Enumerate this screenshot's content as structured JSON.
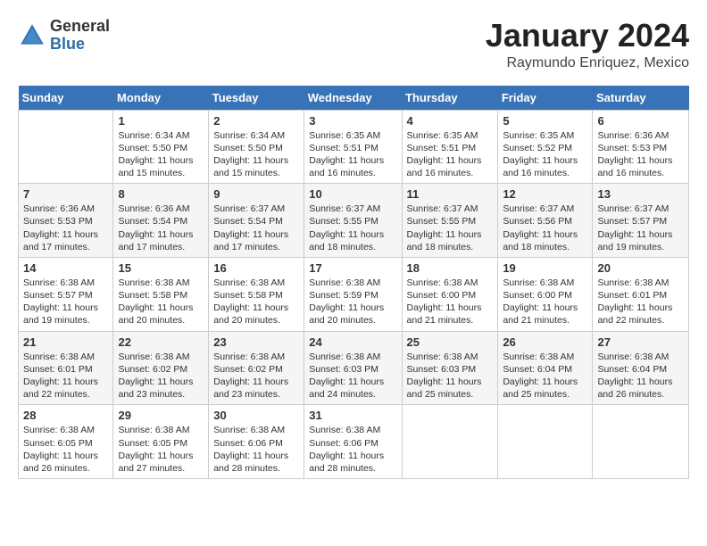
{
  "logo": {
    "general": "General",
    "blue": "Blue"
  },
  "title": "January 2024",
  "location": "Raymundo Enriquez, Mexico",
  "headers": [
    "Sunday",
    "Monday",
    "Tuesday",
    "Wednesday",
    "Thursday",
    "Friday",
    "Saturday"
  ],
  "weeks": [
    [
      {
        "day": "",
        "sunrise": "",
        "sunset": "",
        "daylight": ""
      },
      {
        "day": "1",
        "sunrise": "Sunrise: 6:34 AM",
        "sunset": "Sunset: 5:50 PM",
        "daylight": "Daylight: 11 hours and 15 minutes."
      },
      {
        "day": "2",
        "sunrise": "Sunrise: 6:34 AM",
        "sunset": "Sunset: 5:50 PM",
        "daylight": "Daylight: 11 hours and 15 minutes."
      },
      {
        "day": "3",
        "sunrise": "Sunrise: 6:35 AM",
        "sunset": "Sunset: 5:51 PM",
        "daylight": "Daylight: 11 hours and 16 minutes."
      },
      {
        "day": "4",
        "sunrise": "Sunrise: 6:35 AM",
        "sunset": "Sunset: 5:51 PM",
        "daylight": "Daylight: 11 hours and 16 minutes."
      },
      {
        "day": "5",
        "sunrise": "Sunrise: 6:35 AM",
        "sunset": "Sunset: 5:52 PM",
        "daylight": "Daylight: 11 hours and 16 minutes."
      },
      {
        "day": "6",
        "sunrise": "Sunrise: 6:36 AM",
        "sunset": "Sunset: 5:53 PM",
        "daylight": "Daylight: 11 hours and 16 minutes."
      }
    ],
    [
      {
        "day": "7",
        "sunrise": "Sunrise: 6:36 AM",
        "sunset": "Sunset: 5:53 PM",
        "daylight": "Daylight: 11 hours and 17 minutes."
      },
      {
        "day": "8",
        "sunrise": "Sunrise: 6:36 AM",
        "sunset": "Sunset: 5:54 PM",
        "daylight": "Daylight: 11 hours and 17 minutes."
      },
      {
        "day": "9",
        "sunrise": "Sunrise: 6:37 AM",
        "sunset": "Sunset: 5:54 PM",
        "daylight": "Daylight: 11 hours and 17 minutes."
      },
      {
        "day": "10",
        "sunrise": "Sunrise: 6:37 AM",
        "sunset": "Sunset: 5:55 PM",
        "daylight": "Daylight: 11 hours and 18 minutes."
      },
      {
        "day": "11",
        "sunrise": "Sunrise: 6:37 AM",
        "sunset": "Sunset: 5:55 PM",
        "daylight": "Daylight: 11 hours and 18 minutes."
      },
      {
        "day": "12",
        "sunrise": "Sunrise: 6:37 AM",
        "sunset": "Sunset: 5:56 PM",
        "daylight": "Daylight: 11 hours and 18 minutes."
      },
      {
        "day": "13",
        "sunrise": "Sunrise: 6:37 AM",
        "sunset": "Sunset: 5:57 PM",
        "daylight": "Daylight: 11 hours and 19 minutes."
      }
    ],
    [
      {
        "day": "14",
        "sunrise": "Sunrise: 6:38 AM",
        "sunset": "Sunset: 5:57 PM",
        "daylight": "Daylight: 11 hours and 19 minutes."
      },
      {
        "day": "15",
        "sunrise": "Sunrise: 6:38 AM",
        "sunset": "Sunset: 5:58 PM",
        "daylight": "Daylight: 11 hours and 20 minutes."
      },
      {
        "day": "16",
        "sunrise": "Sunrise: 6:38 AM",
        "sunset": "Sunset: 5:58 PM",
        "daylight": "Daylight: 11 hours and 20 minutes."
      },
      {
        "day": "17",
        "sunrise": "Sunrise: 6:38 AM",
        "sunset": "Sunset: 5:59 PM",
        "daylight": "Daylight: 11 hours and 20 minutes."
      },
      {
        "day": "18",
        "sunrise": "Sunrise: 6:38 AM",
        "sunset": "Sunset: 6:00 PM",
        "daylight": "Daylight: 11 hours and 21 minutes."
      },
      {
        "day": "19",
        "sunrise": "Sunrise: 6:38 AM",
        "sunset": "Sunset: 6:00 PM",
        "daylight": "Daylight: 11 hours and 21 minutes."
      },
      {
        "day": "20",
        "sunrise": "Sunrise: 6:38 AM",
        "sunset": "Sunset: 6:01 PM",
        "daylight": "Daylight: 11 hours and 22 minutes."
      }
    ],
    [
      {
        "day": "21",
        "sunrise": "Sunrise: 6:38 AM",
        "sunset": "Sunset: 6:01 PM",
        "daylight": "Daylight: 11 hours and 22 minutes."
      },
      {
        "day": "22",
        "sunrise": "Sunrise: 6:38 AM",
        "sunset": "Sunset: 6:02 PM",
        "daylight": "Daylight: 11 hours and 23 minutes."
      },
      {
        "day": "23",
        "sunrise": "Sunrise: 6:38 AM",
        "sunset": "Sunset: 6:02 PM",
        "daylight": "Daylight: 11 hours and 23 minutes."
      },
      {
        "day": "24",
        "sunrise": "Sunrise: 6:38 AM",
        "sunset": "Sunset: 6:03 PM",
        "daylight": "Daylight: 11 hours and 24 minutes."
      },
      {
        "day": "25",
        "sunrise": "Sunrise: 6:38 AM",
        "sunset": "Sunset: 6:03 PM",
        "daylight": "Daylight: 11 hours and 25 minutes."
      },
      {
        "day": "26",
        "sunrise": "Sunrise: 6:38 AM",
        "sunset": "Sunset: 6:04 PM",
        "daylight": "Daylight: 11 hours and 25 minutes."
      },
      {
        "day": "27",
        "sunrise": "Sunrise: 6:38 AM",
        "sunset": "Sunset: 6:04 PM",
        "daylight": "Daylight: 11 hours and 26 minutes."
      }
    ],
    [
      {
        "day": "28",
        "sunrise": "Sunrise: 6:38 AM",
        "sunset": "Sunset: 6:05 PM",
        "daylight": "Daylight: 11 hours and 26 minutes."
      },
      {
        "day": "29",
        "sunrise": "Sunrise: 6:38 AM",
        "sunset": "Sunset: 6:05 PM",
        "daylight": "Daylight: 11 hours and 27 minutes."
      },
      {
        "day": "30",
        "sunrise": "Sunrise: 6:38 AM",
        "sunset": "Sunset: 6:06 PM",
        "daylight": "Daylight: 11 hours and 28 minutes."
      },
      {
        "day": "31",
        "sunrise": "Sunrise: 6:38 AM",
        "sunset": "Sunset: 6:06 PM",
        "daylight": "Daylight: 11 hours and 28 minutes."
      },
      {
        "day": "",
        "sunrise": "",
        "sunset": "",
        "daylight": ""
      },
      {
        "day": "",
        "sunrise": "",
        "sunset": "",
        "daylight": ""
      },
      {
        "day": "",
        "sunrise": "",
        "sunset": "",
        "daylight": ""
      }
    ]
  ]
}
